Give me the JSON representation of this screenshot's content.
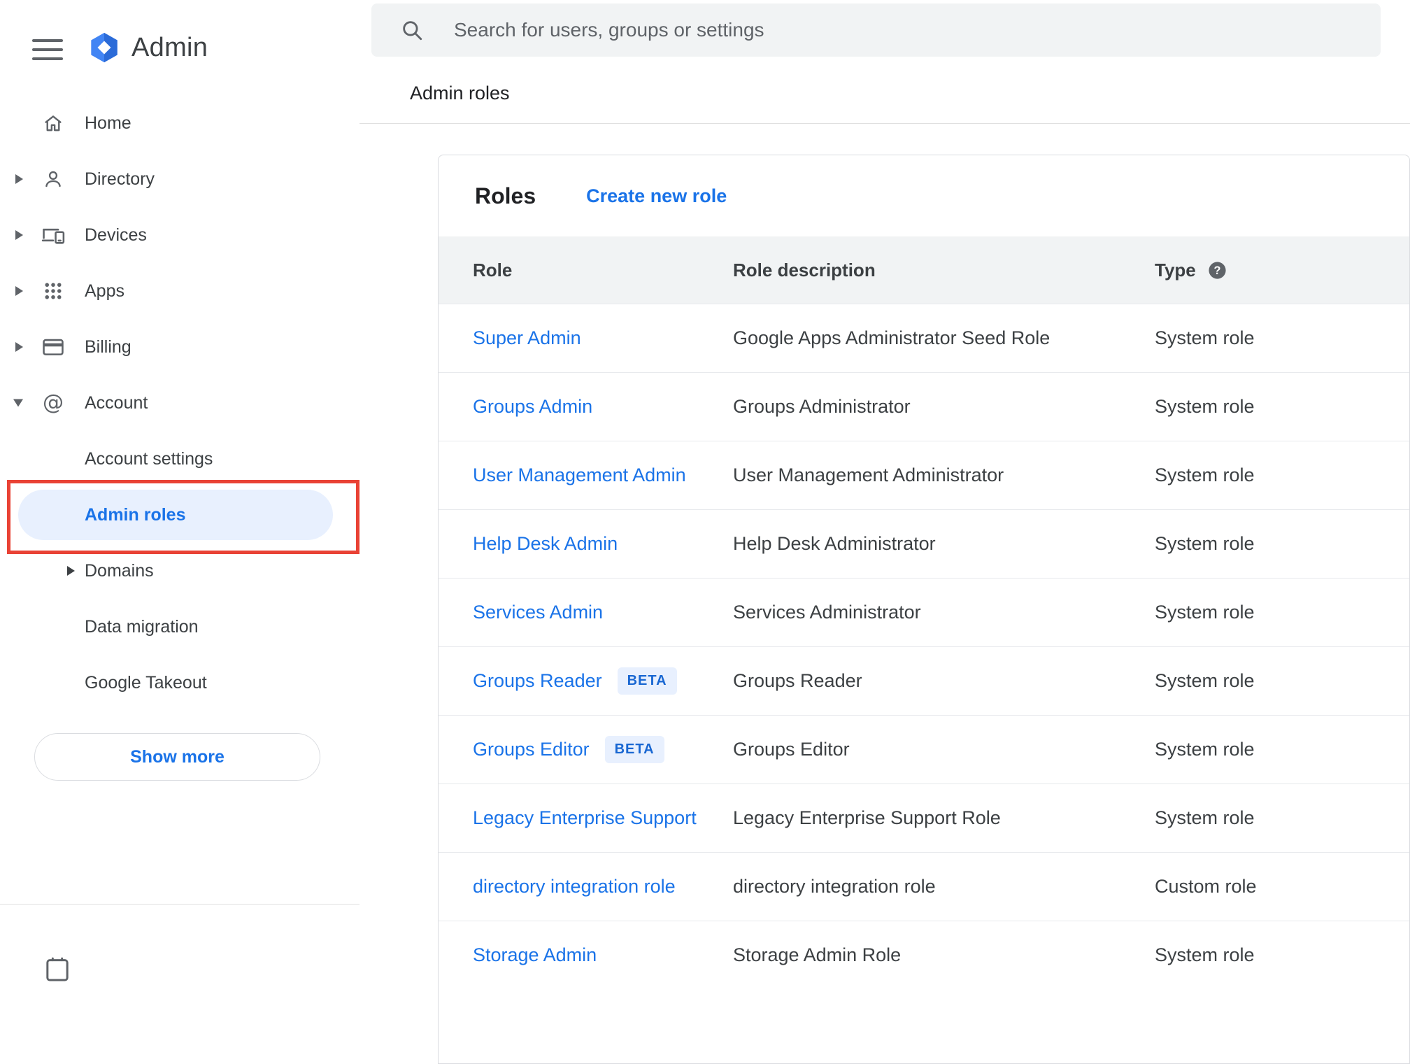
{
  "colors": {
    "link_blue": "#1a73e8",
    "selected_item_bg": "#e8f0fe",
    "beta_badge_bg": "#e8f0fe",
    "beta_badge_text": "#1967d2",
    "annotation_red": "#e94235",
    "icon_grey": "#5f6368",
    "text_dark": "#202124",
    "search_bar_bg": "#f1f3f4",
    "table_header_bg": "#f1f3f4",
    "divider": "#e0e0e0"
  },
  "sidebar": {
    "menu_icon": "hamburger-icon",
    "brand": {
      "logo_icon": "admin-hexagon-logo",
      "title": "Admin"
    },
    "items": [
      {
        "label": "Home",
        "icon": "home-icon",
        "arrow": "none"
      },
      {
        "label": "Directory",
        "icon": "person-icon",
        "arrow": "right"
      },
      {
        "label": "Devices",
        "icon": "devices-icon",
        "arrow": "right"
      },
      {
        "label": "Apps",
        "icon": "apps-grid-icon",
        "arrow": "right"
      },
      {
        "label": "Billing",
        "icon": "billing-card-icon",
        "arrow": "right"
      },
      {
        "label": "Account",
        "icon": "at-sign-icon",
        "arrow": "down"
      }
    ],
    "account_subitems": [
      {
        "label": "Account settings",
        "selected": false,
        "arrow": "none"
      },
      {
        "label": "Admin roles",
        "selected": true,
        "arrow": "none"
      },
      {
        "label": "Domains",
        "selected": false,
        "arrow": "right"
      },
      {
        "label": "Data migration",
        "selected": false,
        "arrow": "none"
      },
      {
        "label": "Google Takeout",
        "selected": false,
        "arrow": "none"
      }
    ],
    "show_more_label": "Show more"
  },
  "search": {
    "icon": "search-icon",
    "placeholder": "Search for users, groups or settings"
  },
  "breadcrumb": "Admin roles",
  "roles_card": {
    "title": "Roles",
    "create_link": "Create new role",
    "table": {
      "columns": [
        "Role",
        "Role description",
        "Type"
      ],
      "type_help_icon": "help-icon",
      "beta_badge_label": "BETA",
      "rows": [
        {
          "role": "Super Admin",
          "beta": false,
          "description": "Google Apps Administrator Seed Role",
          "type": "System role"
        },
        {
          "role": "Groups Admin",
          "beta": false,
          "description": "Groups Administrator",
          "type": "System role"
        },
        {
          "role": "User Management Admin",
          "beta": false,
          "description": "User Management Administrator",
          "type": "System role"
        },
        {
          "role": "Help Desk Admin",
          "beta": false,
          "description": "Help Desk Administrator",
          "type": "System role"
        },
        {
          "role": "Services Admin",
          "beta": false,
          "description": "Services Administrator",
          "type": "System role"
        },
        {
          "role": "Groups Reader",
          "beta": true,
          "description": "Groups Reader",
          "type": "System role"
        },
        {
          "role": "Groups Editor",
          "beta": true,
          "description": "Groups Editor",
          "type": "System role"
        },
        {
          "role": "Legacy Enterprise Support",
          "beta": false,
          "description": "Legacy Enterprise Support Role",
          "type": "System role"
        },
        {
          "role": "directory integration role",
          "beta": false,
          "description": "directory integration role",
          "type": "Custom role"
        },
        {
          "role": "Storage Admin",
          "beta": false,
          "description": "Storage Admin Role",
          "type": "System role"
        }
      ]
    }
  }
}
